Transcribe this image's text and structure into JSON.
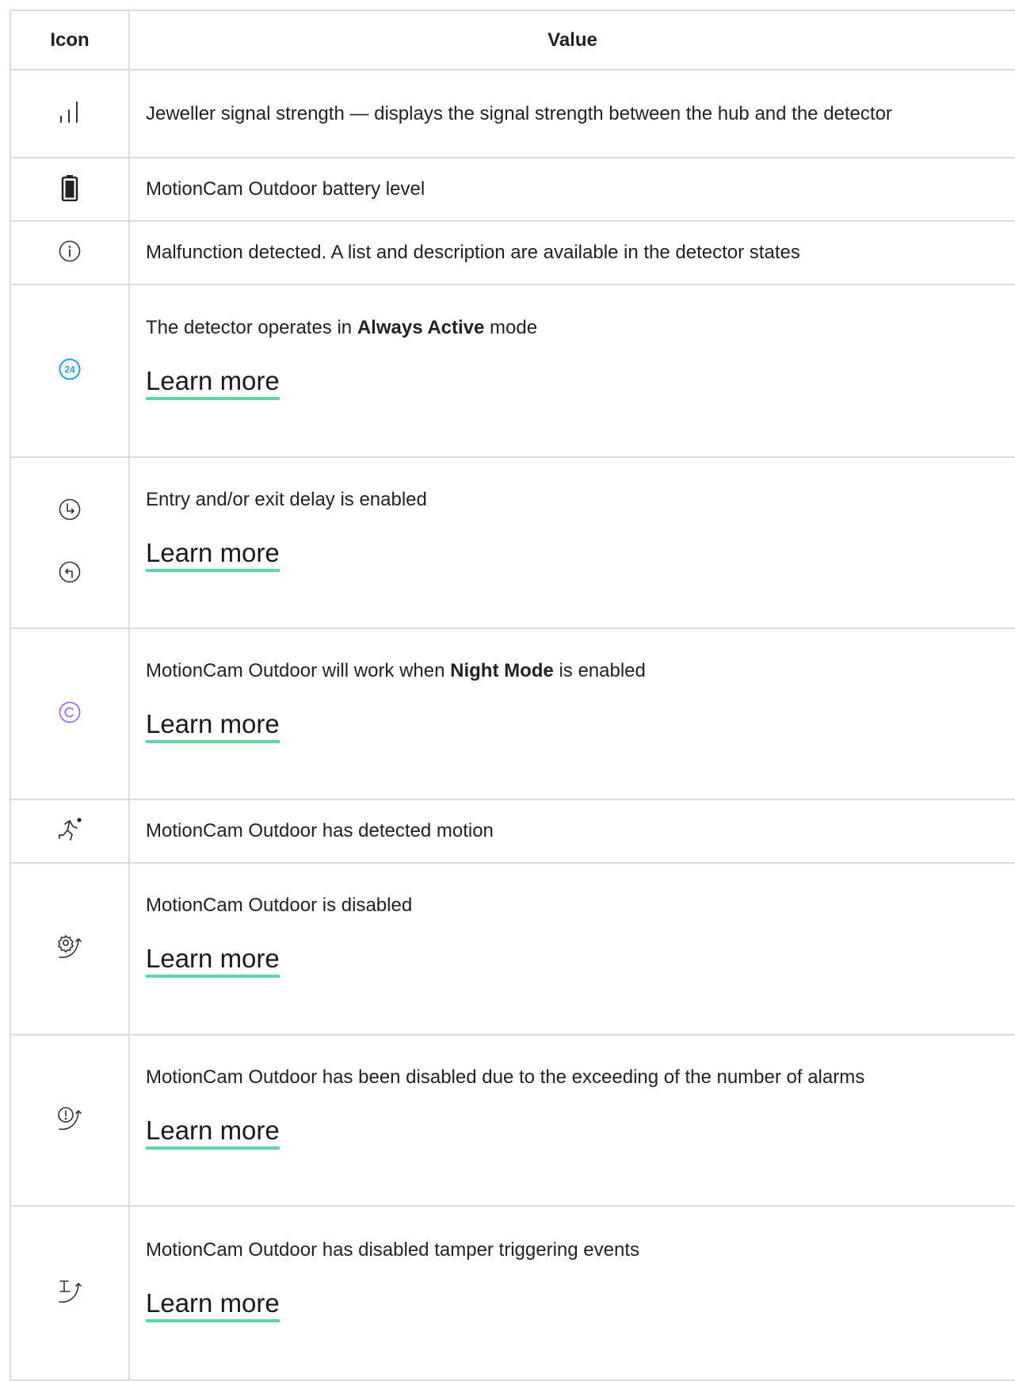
{
  "table": {
    "headers": {
      "icon": "Icon",
      "value": "Value"
    },
    "rows": [
      {
        "icon": "signal-strength-icon",
        "text": "Jeweller signal strength — displays the signal strength between the hub and the detector"
      },
      {
        "icon": "battery-icon",
        "text": "MotionCam Outdoor battery level"
      },
      {
        "icon": "info-icon",
        "text": "Malfunction detected. A list and description are available in the detector states"
      },
      {
        "icon": "always-active-24-icon",
        "icon_text": "24",
        "text_before": "The detector operates in ",
        "text_bold": "Always Active",
        "text_after": " mode",
        "link": "Learn more",
        "color": "#1aa3e8"
      },
      {
        "icons": [
          "entry-delay-icon",
          "exit-delay-icon"
        ],
        "text": "Entry and/or exit delay is enabled",
        "link": "Learn more"
      },
      {
        "icon": "night-mode-icon",
        "text_before": "MotionCam Outdoor will work when ",
        "text_bold": "Night Mode",
        "text_after": " is enabled",
        "link": "Learn more",
        "color": "#a06bf0"
      },
      {
        "icon": "motion-detected-icon",
        "text": "MotionCam Outdoor has detected motion"
      },
      {
        "icon": "device-disabled-icon",
        "text": "MotionCam Outdoor is disabled",
        "link": "Learn more"
      },
      {
        "icon": "alarms-exceeded-disabled-icon",
        "text": "MotionCam Outdoor has been disabled due to the exceeding of the number of alarms",
        "link": "Learn more"
      },
      {
        "icon": "tamper-disabled-icon",
        "text": "MotionCam Outdoor has disabled tamper triggering events",
        "link": "Learn more"
      }
    ]
  },
  "colors": {
    "link_underline": "#5fd7a3",
    "border": "#dcdcdc"
  }
}
